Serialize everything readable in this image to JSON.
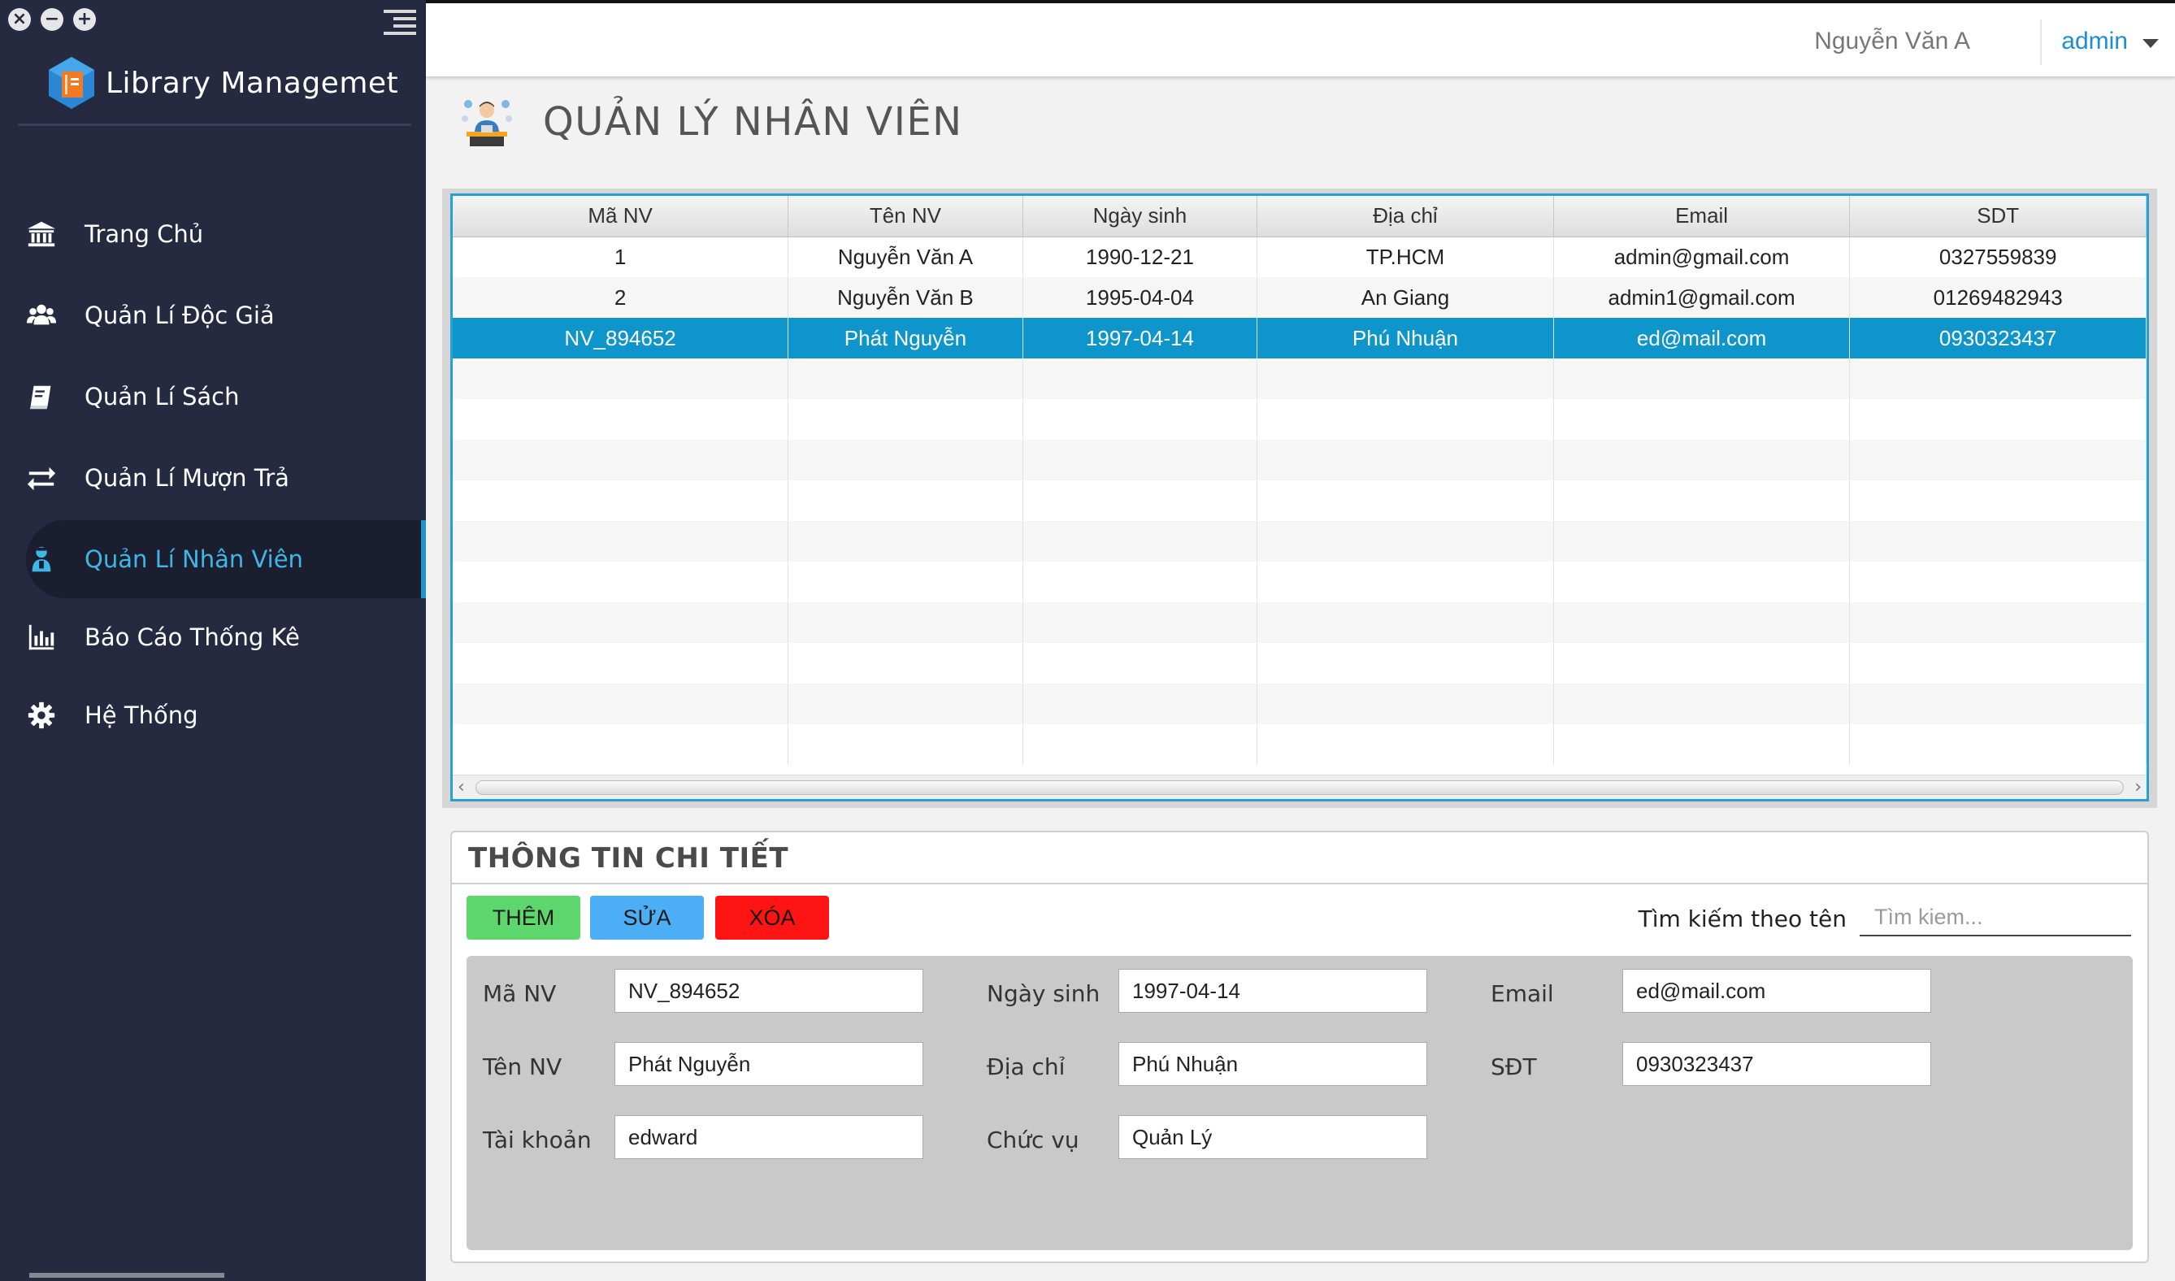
{
  "app": {
    "title": "Library Managemet"
  },
  "window_controls": {
    "close": "×",
    "minimize": "−",
    "maximize": "+"
  },
  "nav": {
    "items": [
      {
        "label": "Trang Chủ",
        "icon": "bank-icon",
        "active": false
      },
      {
        "label": "Quản Lí Độc Giả",
        "icon": "users-icon",
        "active": false
      },
      {
        "label": "Quản Lí Sách",
        "icon": "book-icon",
        "active": false
      },
      {
        "label": "Quản Lí Mượn Trả",
        "icon": "exchange-icon",
        "active": false
      },
      {
        "label": "Quản Lí Nhân Viên",
        "icon": "employee-icon",
        "active": true
      },
      {
        "label": "Báo Cáo Thống Kê",
        "icon": "bar-chart-icon",
        "active": false
      },
      {
        "label": "Hệ Thống",
        "icon": "gear-icon",
        "active": false
      }
    ]
  },
  "topbar": {
    "user_name": "Nguyễn Văn A",
    "role": "admin"
  },
  "page": {
    "title": "QUẢN LÝ NHÂN VIÊN"
  },
  "table": {
    "columns": [
      "Mã NV",
      "Tên NV",
      "Ngày sinh",
      "Địa chỉ",
      "Email",
      "SDT"
    ],
    "rows": [
      [
        "1",
        "Nguyễn Văn A",
        "1990-12-21",
        "TP.HCM",
        "admin@gmail.com",
        "0327559839"
      ],
      [
        "2",
        "Nguyễn Văn B",
        "1995-04-04",
        "An Giang",
        "admin1@gmail.com",
        "01269482943"
      ],
      [
        "NV_894652",
        "Phát Nguyễn",
        "1997-04-14",
        "Phú Nhuận",
        "ed@mail.com",
        "0930323437"
      ]
    ],
    "selected_row": 2,
    "scroll_left": "‹",
    "scroll_right": "›"
  },
  "detail": {
    "title": "THÔNG TIN CHI TIẾT",
    "buttons": {
      "add": "THÊM",
      "edit": "SỬA",
      "delete": "XÓA"
    },
    "search": {
      "label": "Tìm kiếm theo tên",
      "placeholder": "Tìm kiem..."
    },
    "fields": {
      "ma_nv": {
        "label": "Mã NV",
        "value": "NV_894652"
      },
      "ten_nv": {
        "label": "Tên NV",
        "value": "Phát Nguyễn"
      },
      "tai_khoan": {
        "label": "Tài khoản",
        "value": "edward"
      },
      "ngay_sinh": {
        "label": "Ngày sinh",
        "value": "1997-04-14"
      },
      "dia_chi": {
        "label": "Địa chỉ",
        "value": "Phú Nhuận"
      },
      "chuc_vu": {
        "label": "Chức vụ",
        "value": "Quản Lý"
      },
      "email": {
        "label": "Email",
        "value": "ed@mail.com"
      },
      "sdt": {
        "label": "SĐT",
        "value": "0930323437"
      }
    }
  },
  "colors": {
    "sidebar_bg": "#252a41",
    "accent": "#1f93cf",
    "selected_row": "#0e96cc",
    "btn_add": "#5dd66e",
    "btn_edit": "#4caff5",
    "btn_delete": "#ff1414"
  }
}
